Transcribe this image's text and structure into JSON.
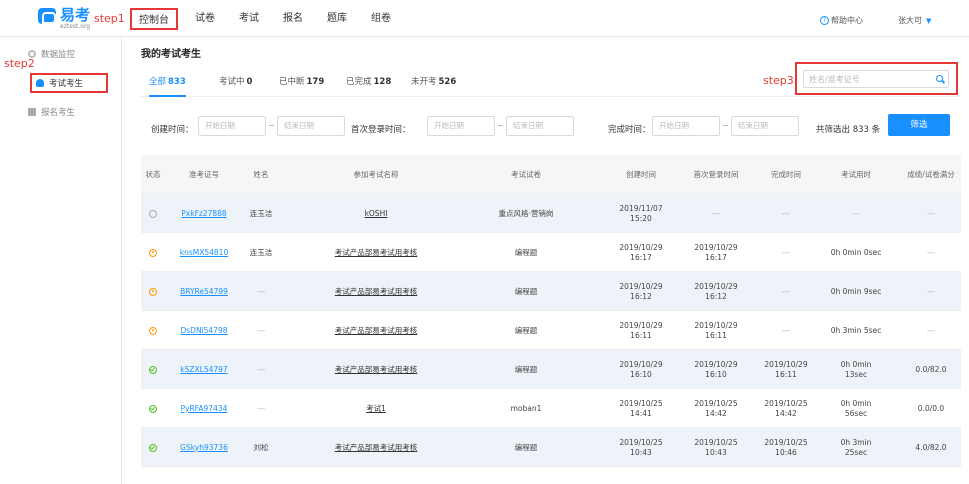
{
  "header": {
    "logo_text": "易考",
    "logo_sub": "eztest.org",
    "nav": [
      "控制台",
      "试卷",
      "考试",
      "报名",
      "题库",
      "组卷"
    ],
    "help": "帮助中心",
    "user": "张大可"
  },
  "annotations": {
    "step1": "step1",
    "step2": "step2",
    "step3": "step3"
  },
  "sidebar": {
    "items": [
      {
        "label": "数据监控",
        "icon": "dashboard-icon"
      },
      {
        "label": "考试考生",
        "icon": "person-icon"
      },
      {
        "label": "报名考生",
        "icon": "document-icon"
      }
    ]
  },
  "main": {
    "title": "我的考试考生",
    "tabs": [
      {
        "label": "全部",
        "count": "833"
      },
      {
        "label": "考试中",
        "count": "0"
      },
      {
        "label": "已中断",
        "count": "179"
      },
      {
        "label": "已完成",
        "count": "128"
      },
      {
        "label": "未开考",
        "count": "526"
      }
    ],
    "search": {
      "placeholder": "姓名/准考证号"
    }
  },
  "filters": {
    "created_label": "创建时间：",
    "first_login_label": "首次登录时间：",
    "finished_label": "完成时间：",
    "start_placeholder": "开始日期",
    "end_placeholder": "结束日期",
    "count_text": "共筛选出 833 条",
    "button": "筛选"
  },
  "table": {
    "headers": [
      "状态",
      "准考证号",
      "姓名",
      "参加考试名称",
      "考试试卷",
      "创建时间",
      "首次登录时间",
      "完成时间",
      "考试用时",
      "成绩/试卷满分"
    ],
    "rows": [
      {
        "status": "pending",
        "id": "PxkFz27888",
        "name": "连玉洁",
        "exam": "kOSHI",
        "paper": "重点风格·营销岗",
        "created": "2019/11/07\n15:20",
        "first_login": "---",
        "finished": "---",
        "duration": "---",
        "score": "---"
      },
      {
        "status": "progress",
        "id": "knsMX54810",
        "name": "连玉洁",
        "exam": "考试产品部易考试用考核",
        "paper": "编程题",
        "created": "2019/10/29\n16:17",
        "first_login": "2019/10/29\n16:17",
        "finished": "---",
        "duration": "0h 0min 0sec",
        "score": "---"
      },
      {
        "status": "progress",
        "id": "BRYRe54799",
        "name": "---",
        "exam": "考试产品部易考试用考核",
        "paper": "编程题",
        "created": "2019/10/29\n16:12",
        "first_login": "2019/10/29\n16:12",
        "finished": "---",
        "duration": "0h 0min 9sec",
        "score": "---"
      },
      {
        "status": "progress",
        "id": "DsDNi54798",
        "name": "---",
        "exam": "考试产品部易考试用考核",
        "paper": "编程题",
        "created": "2019/10/29\n16:11",
        "first_login": "2019/10/29\n16:11",
        "finished": "---",
        "duration": "0h 3min 5sec",
        "score": "---"
      },
      {
        "status": "done",
        "id": "kSZXL54797",
        "name": "---",
        "exam": "考试产品部易考试用考核",
        "paper": "编程题",
        "created": "2019/10/29\n16:10",
        "first_login": "2019/10/29\n16:10",
        "finished": "2019/10/29\n16:11",
        "duration": "0h 0min\n13sec",
        "score": "0.0/82.0"
      },
      {
        "status": "done",
        "id": "PyRFA97434",
        "name": "---",
        "exam": "考试1",
        "paper": "moban1",
        "created": "2019/10/25\n14:41",
        "first_login": "2019/10/25\n14:42",
        "finished": "2019/10/25\n14:42",
        "duration": "0h 0min\n56sec",
        "score": "0.0/0.0"
      },
      {
        "status": "done",
        "id": "GSkyh93736",
        "name": "刘松",
        "exam": "考试产品部易考试用考核",
        "paper": "编程题",
        "created": "2019/10/25\n10:43",
        "first_login": "2019/10/25\n10:43",
        "finished": "2019/10/25\n10:46",
        "duration": "0h 3min\n25sec",
        "score": "4.0/82.0"
      }
    ]
  }
}
